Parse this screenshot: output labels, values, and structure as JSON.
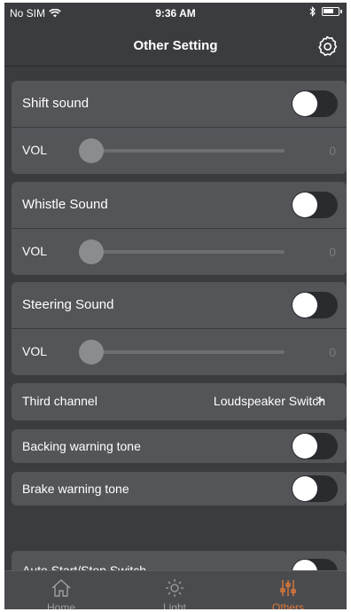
{
  "status_bar": {
    "carrier": "No SIM",
    "time": "9:36 AM"
  },
  "nav": {
    "title": "Other Setting"
  },
  "sections": {
    "shift": {
      "label": "Shift sound",
      "vol_label": "VOL",
      "vol_value": "0",
      "on": false,
      "level": 0
    },
    "whistle": {
      "label": "Whistle Sound",
      "vol_label": "VOL",
      "vol_value": "0",
      "on": false,
      "level": 0
    },
    "steering": {
      "label": "Steering Sound",
      "vol_label": "VOL",
      "vol_value": "0",
      "on": false,
      "level": 0
    }
  },
  "third_channel": {
    "label": "Third channel",
    "value": "Loudspeaker Switch",
    "chevron": ">"
  },
  "backing": {
    "label": "Backing warning tone",
    "on": false
  },
  "brake": {
    "label": "Brake warning tone",
    "on": false
  },
  "auto_start": {
    "label": "Auto Start/Stop Switch",
    "on": false
  },
  "tabs": [
    {
      "label": "Home",
      "icon": "home-icon",
      "active": false
    },
    {
      "label": "Light",
      "icon": "sun-icon",
      "active": false
    },
    {
      "label": "Others",
      "icon": "sliders-icon",
      "active": true
    }
  ],
  "colors": {
    "background": "#3b3c3f",
    "row": "#545559",
    "accent": "#e07a3a"
  }
}
